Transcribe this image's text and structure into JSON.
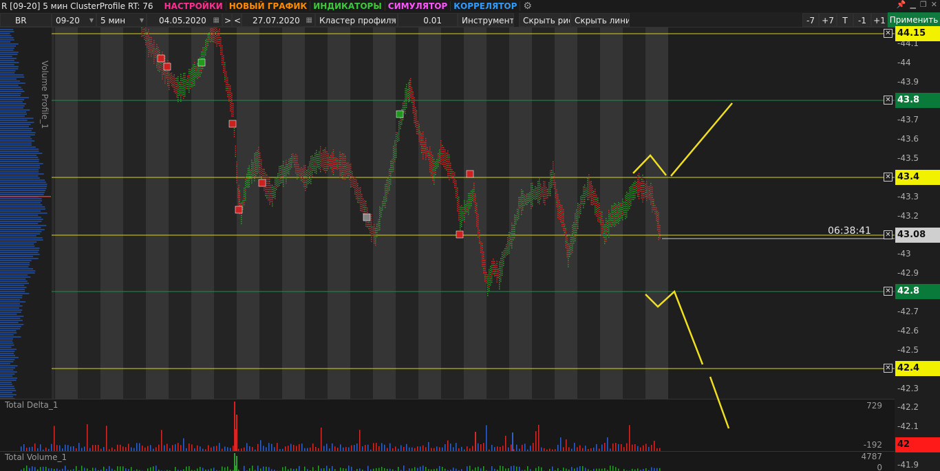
{
  "window": {
    "title": "R [09-20] 5 мин ClusterProfile RT: 76"
  },
  "menu": [
    {
      "label": "НАСТРОЙКИ",
      "color": "#ff2f92"
    },
    {
      "label": "НОВЫЙ ГРАФИК",
      "color": "#ff8a00"
    },
    {
      "label": "ИНДИКАТОРЫ",
      "color": "#3cc83c"
    },
    {
      "label": "СИМУЛЯТОР",
      "color": "#ff55ff"
    },
    {
      "label": "КОРРЕЛЯТОР",
      "color": "#2f9bff"
    }
  ],
  "toolbar": {
    "symbol": "BR",
    "contract": "09-20",
    "timeframe": "5 мин",
    "date_from": "04.05.2020",
    "nav_next": ">",
    "nav_prev": "<",
    "date_to": "27.07.2020",
    "profile_mode": "Кластер профиля",
    "step": "0.01",
    "tools": "Инструменты",
    "hide_drawings": "Скрыть рис.",
    "hide_lines": "Скрыть линии",
    "minus7": "-7",
    "plus7": "+7",
    "t": "T",
    "minus1": "-1",
    "plus1": "+1",
    "apply": "Применить"
  },
  "chart": {
    "volume_profile_title": "Volume Profile_1",
    "countdown": "06:38:41",
    "y_ticks": [
      "44.1",
      "44",
      "43.9",
      "43.7",
      "43.6",
      "43.5",
      "43.3",
      "43.2",
      "43.1",
      "43",
      "42.9",
      "42.7",
      "42.6",
      "42.5",
      "42.3",
      "42.2",
      "42.1",
      "41.9"
    ],
    "price_min": 41.9,
    "price_max": 44.15,
    "levels": [
      {
        "value": "44.15",
        "bg": "#f2f200",
        "fg": "#111111",
        "line": "#d8d818"
      },
      {
        "value": "43.8",
        "bg": "#0a7a3a",
        "fg": "#ffffff",
        "line": "#1f8f4a"
      },
      {
        "value": "43.4",
        "bg": "#f2f200",
        "fg": "#111111",
        "line": "#d8d818"
      },
      {
        "value": "43.08",
        "bg": "#cfcfcf",
        "fg": "#111111",
        "line": "#e0e000"
      },
      {
        "value": "42.8",
        "bg": "#0a7a3a",
        "fg": "#ffffff",
        "line": "#1f8f4a"
      },
      {
        "value": "42.4",
        "bg": "#f2f200",
        "fg": "#111111",
        "line": "#d8d818"
      },
      {
        "value": "42",
        "bg": "#ff1a1a",
        "fg": "#111111",
        "line": "#ff1a1a"
      }
    ],
    "colors": {
      "up": "#2e9e2e",
      "down": "#d42a2a",
      "forecast": "#f0e020"
    }
  },
  "panes": {
    "delta": {
      "title": "Total Delta_1",
      "max": "729",
      "min": "-192"
    },
    "volume": {
      "title": "Total Volume_1",
      "max": "4787",
      "min": "0"
    }
  }
}
